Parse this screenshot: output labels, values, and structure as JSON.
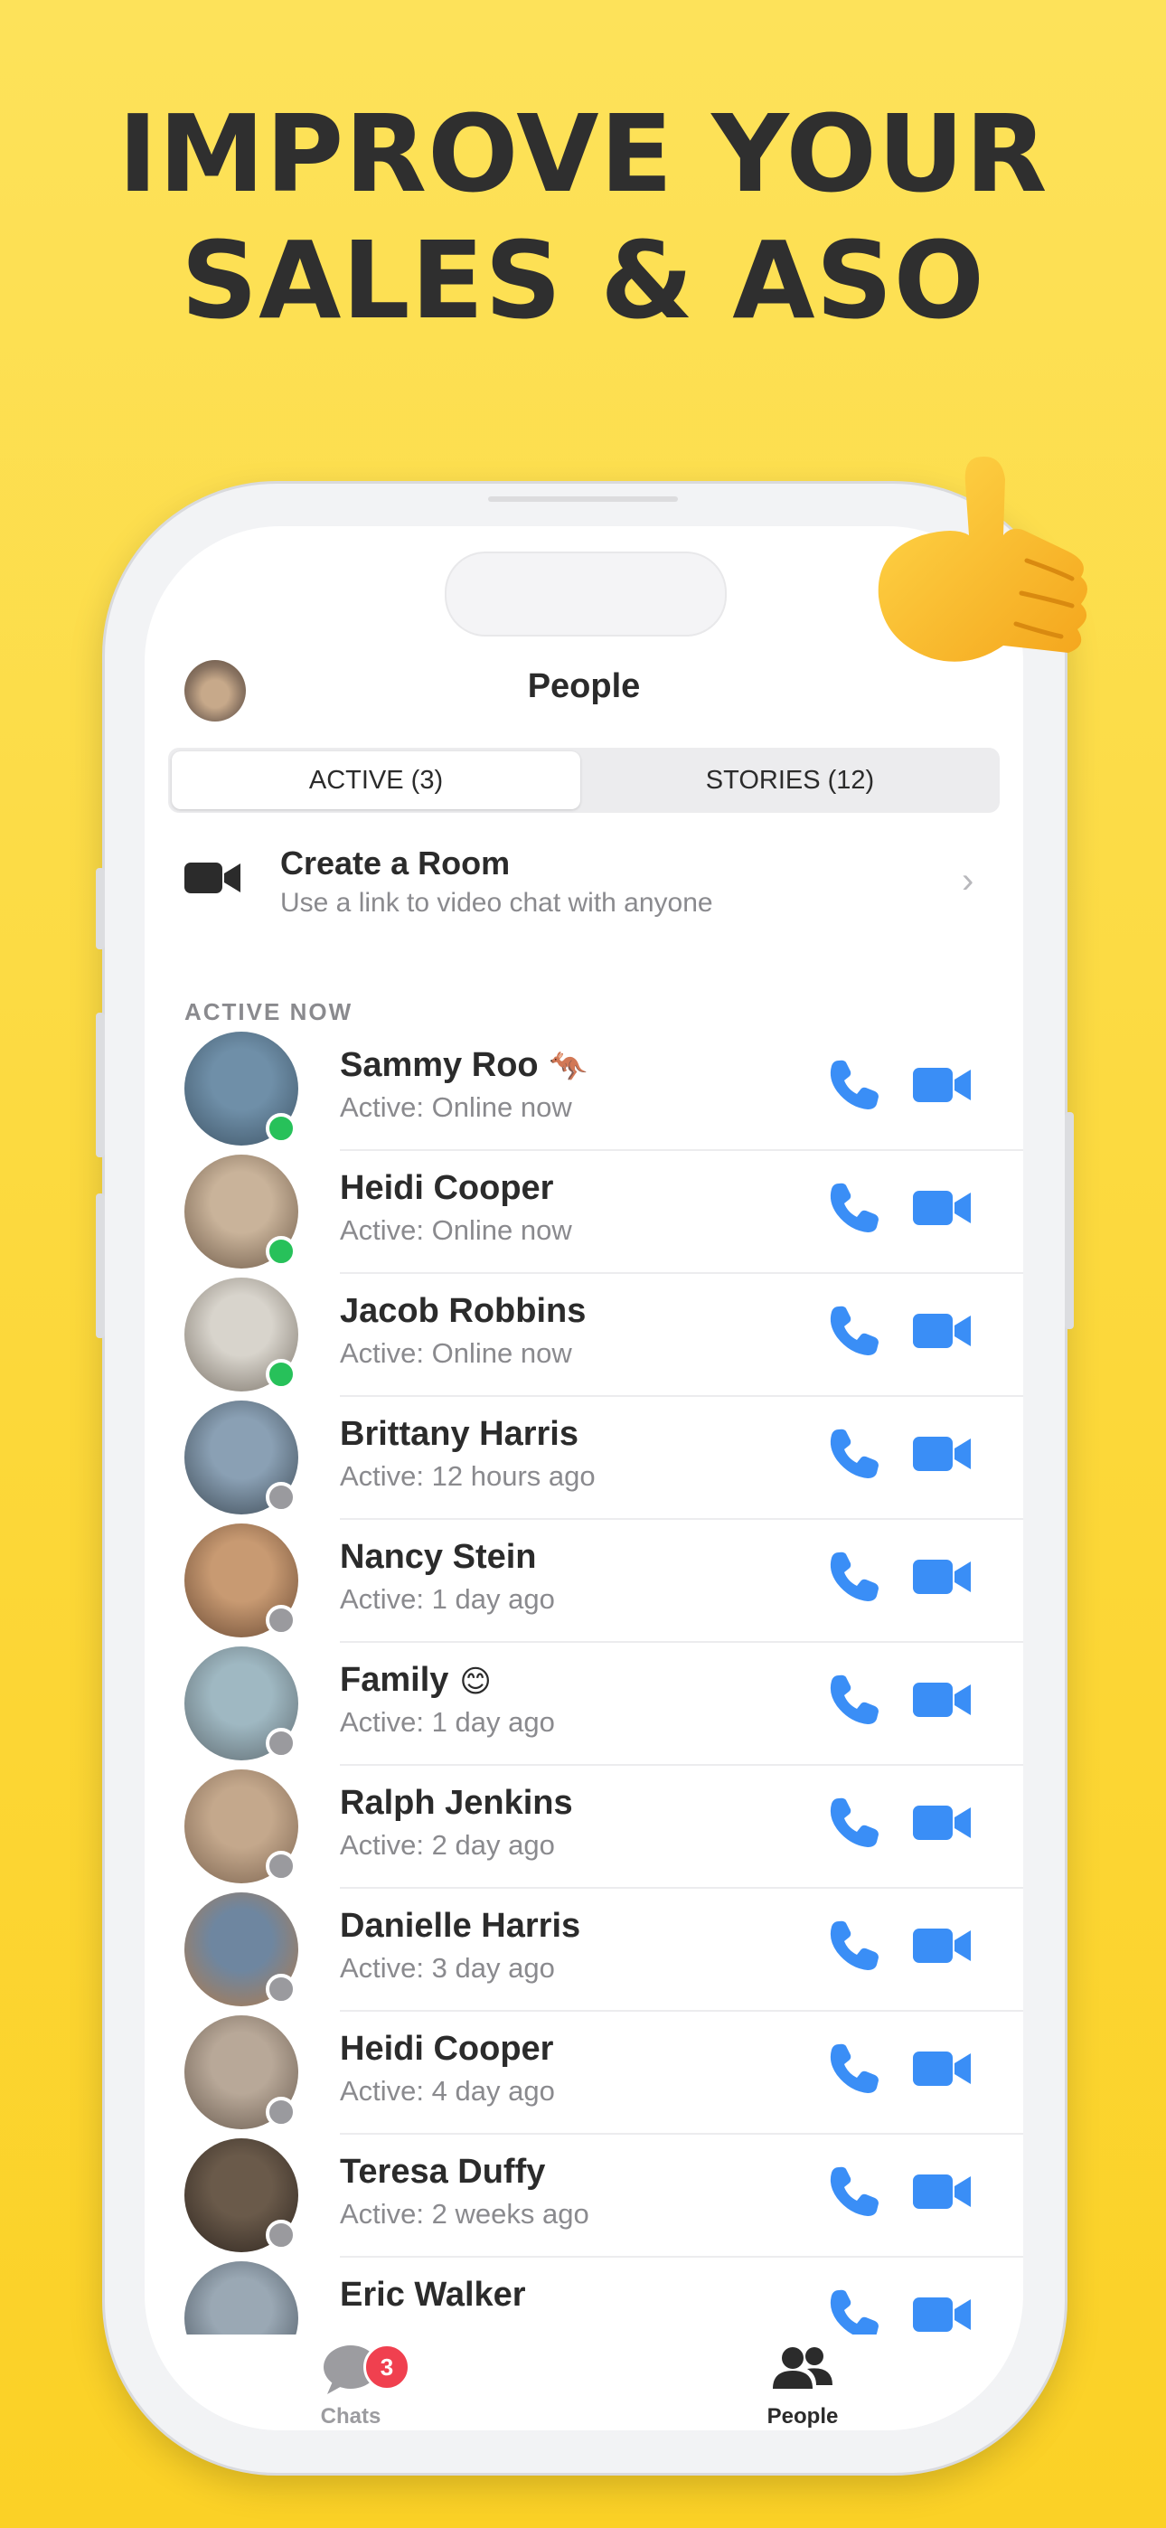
{
  "headline": {
    "line1": "IMPROVE YOUR",
    "line2": "SALES & ASO"
  },
  "header": {
    "title": "People"
  },
  "tabs": {
    "active": "ACTIVE (3)",
    "stories": "STORIES (12)"
  },
  "room": {
    "title": "Create a Room",
    "subtitle": "Use a link to video chat with anyone",
    "chevron": "›"
  },
  "section": {
    "label": "ACTIVE NOW"
  },
  "colors": {
    "accent": "#3a8ef6",
    "online": "#27c15a",
    "offline": "#9a9a9e",
    "badge": "#f0404f",
    "background": "#fcd83a"
  },
  "people": [
    {
      "name": "Sammy Roo",
      "emoji": "🦘",
      "status": "Active: Online now",
      "online": true
    },
    {
      "name": "Heidi Cooper",
      "emoji": "",
      "status": "Active: Online now",
      "online": true
    },
    {
      "name": "Jacob Robbins",
      "emoji": "",
      "status": "Active: Online now",
      "online": true
    },
    {
      "name": "Brittany Harris",
      "emoji": "",
      "status": "Active: 12 hours ago",
      "online": false
    },
    {
      "name": "Nancy Stein",
      "emoji": "",
      "status": "Active: 1 day ago",
      "online": false
    },
    {
      "name": "Family",
      "emoji": "😊",
      "status": "Active: 1 day ago",
      "online": false
    },
    {
      "name": "Ralph Jenkins",
      "emoji": "",
      "status": "Active: 2 day ago",
      "online": false
    },
    {
      "name": "Danielle Harris",
      "emoji": "",
      "status": "Active: 3 day ago",
      "online": false
    },
    {
      "name": "Heidi Cooper",
      "emoji": "",
      "status": "Active: 4 day ago",
      "online": false
    },
    {
      "name": "Teresa Duffy",
      "emoji": "",
      "status": "Active: 2 weeks ago",
      "online": false
    },
    {
      "name": "Eric Walker",
      "emoji": "",
      "status": "",
      "online": false
    }
  ],
  "tabbar": {
    "chats_label": "Chats",
    "chats_badge": "3",
    "people_label": "People"
  },
  "icons": {
    "call": "phone-icon",
    "video": "video-camera-icon",
    "chats": "chat-bubble-icon",
    "people": "people-icon",
    "decoration": "call-me-hand-emoji"
  }
}
